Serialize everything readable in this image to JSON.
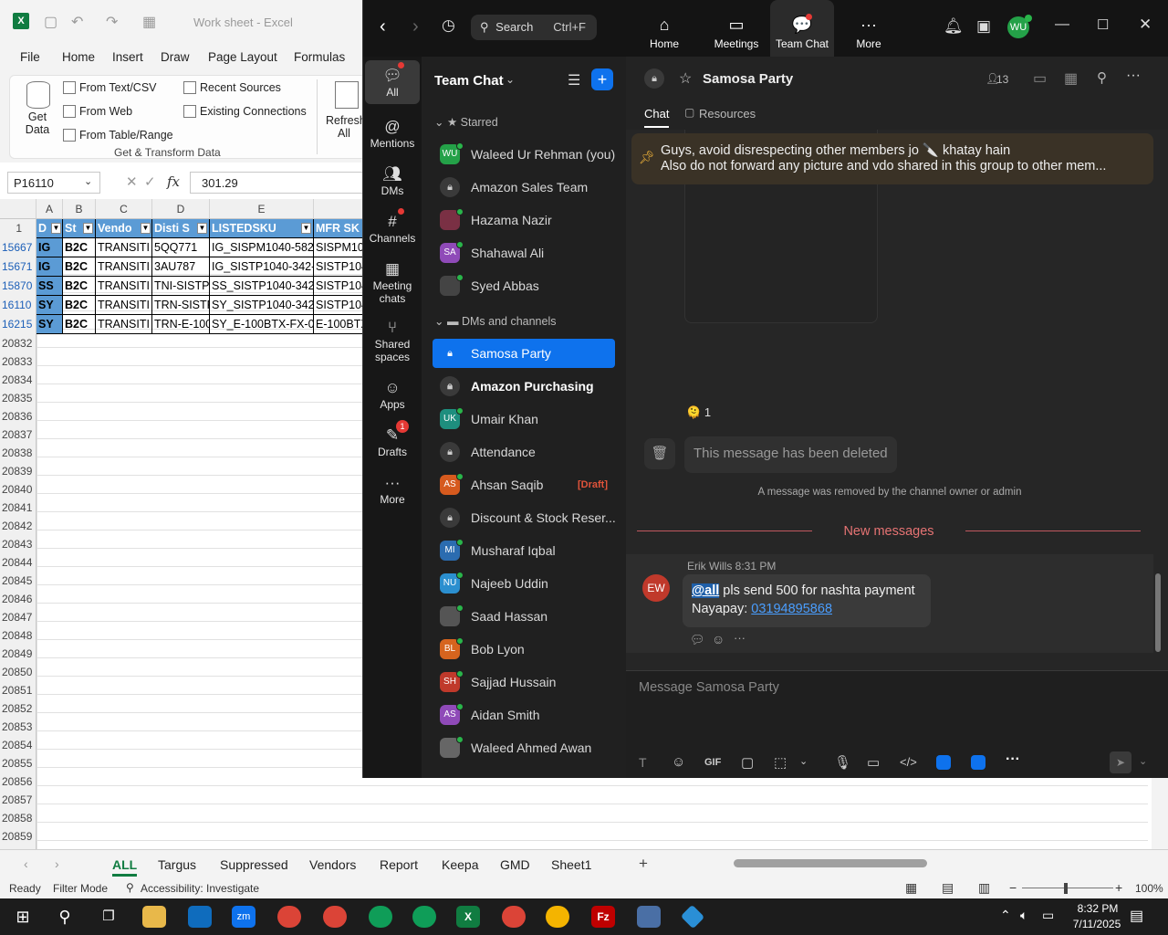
{
  "excel": {
    "title": "Work sheet  -  Excel",
    "menu": [
      "File",
      "Home",
      "Insert",
      "Draw",
      "Page Layout",
      "Formulas"
    ],
    "ribbon": {
      "get_data": "Get\nData",
      "from_text_csv": "From Text/CSV",
      "from_web": "From Web",
      "from_table_range": "From Table/Range",
      "recent_sources": "Recent Sources",
      "existing_connections": "Existing Connections",
      "refresh_all": "Refresh\nAll",
      "group_label": "Get & Transform Data"
    },
    "name_box": "P16110",
    "formula_value": "301.29",
    "columns": [
      "A",
      "B",
      "C",
      "D",
      "E"
    ],
    "header_row": {
      "num": "1",
      "cells": [
        "D",
        "St",
        "Vendo",
        "Disti S",
        "LISTEDSKU",
        "MFR SK"
      ]
    },
    "rows": [
      {
        "num": "15667",
        "cells": [
          "IG",
          "B2C",
          "TRANSITI",
          "5QQ771",
          "IG_SISPM1040-582",
          "SISPM10"
        ]
      },
      {
        "num": "15671",
        "cells": [
          "IG",
          "B2C",
          "TRANSITI",
          "3AU787",
          "IG_SISTP1040-342-",
          "SISTP104"
        ]
      },
      {
        "num": "15870",
        "cells": [
          "SS",
          "B2C",
          "TRANSITI",
          "TNI-SISTP",
          "SS_SISTP1040-342-",
          "SISTP104"
        ]
      },
      {
        "num": "16110",
        "cells": [
          "SY",
          "B2C",
          "TRANSITI",
          "TRN-SISTF",
          "SY_SISTP1040-342-",
          "SISTP104"
        ]
      },
      {
        "num": "16215",
        "cells": [
          "SY",
          "B2C",
          "TRANSITI",
          "TRN-E-100",
          "SY_E-100BTX-FX-0",
          "E-100BTX"
        ]
      }
    ],
    "empty_rows": [
      "20832",
      "20833",
      "20834",
      "20835",
      "20836",
      "20837",
      "20838",
      "20839",
      "20840",
      "20841",
      "20842",
      "20843",
      "20844",
      "20845",
      "20846",
      "20847",
      "20848",
      "20849",
      "20850",
      "20851",
      "20852",
      "20853",
      "20854",
      "20855",
      "20856",
      "20857",
      "20858",
      "20859"
    ],
    "sheets": [
      "ALL",
      "Targus",
      "Suppressed",
      "Vendors",
      "Report",
      "Keepa",
      "GMD",
      "Sheet1"
    ],
    "status": {
      "ready": "Ready",
      "filter": "Filter Mode",
      "accessibility": "Accessibility: Investigate",
      "zoom": "100%"
    }
  },
  "zoom": {
    "search_label": "Search",
    "search_shortcut": "Ctrl+F",
    "nav": [
      "Home",
      "Meetings",
      "Team Chat",
      "More"
    ],
    "user_initials": "WU",
    "rail": [
      {
        "label": "All",
        "icon": "chat-icon"
      },
      {
        "label": "Mentions",
        "icon": "at-icon"
      },
      {
        "label": "DMs",
        "icon": "people-icon"
      },
      {
        "label": "Channels",
        "icon": "hash-icon"
      },
      {
        "label": "Meeting chats",
        "icon": "calendar-icon"
      },
      {
        "label": "Shared spaces",
        "icon": "share-icon"
      },
      {
        "label": "Apps",
        "icon": "apps-icon"
      },
      {
        "label": "Drafts",
        "icon": "drafts-icon",
        "badge": "1"
      },
      {
        "label": "More",
        "icon": "more-icon"
      }
    ],
    "list_title": "Team Chat",
    "starred_label": "Starred",
    "starred": [
      {
        "name": "Waleed Ur Rehman (you)",
        "type": "avatar",
        "initials": "WU",
        "color": "#24a148"
      },
      {
        "name": "Amazon Sales Team",
        "type": "lock"
      },
      {
        "name": "Hazama Nazir",
        "type": "photo",
        "color": "#7a3044"
      },
      {
        "name": "Shahawal Ali",
        "type": "avatar",
        "initials": "SA",
        "color": "#8f4ab8"
      },
      {
        "name": "Syed Abbas",
        "type": "photo",
        "color": "#444"
      }
    ],
    "dms_label": "DMs and channels",
    "dms": [
      {
        "name": "Samosa Party",
        "type": "lock",
        "selected": true
      },
      {
        "name": "Amazon Purchasing",
        "type": "lock",
        "bold": true
      },
      {
        "name": "Umair Khan",
        "type": "avatar",
        "initials": "UK",
        "color": "#1e8e7e"
      },
      {
        "name": "Attendance",
        "type": "lock"
      },
      {
        "name": "Ahsan Saqib",
        "type": "avatar",
        "initials": "AS",
        "color": "#d65a1e",
        "draft": "[Draft]"
      },
      {
        "name": "Discount & Stock Reser...",
        "type": "lock"
      },
      {
        "name": "Musharaf Iqbal",
        "type": "avatar",
        "initials": "MI",
        "color": "#2b6cb0"
      },
      {
        "name": "Najeeb Uddin",
        "type": "avatar",
        "initials": "NU",
        "color": "#2b8fcf"
      },
      {
        "name": "Saad Hassan",
        "type": "photo",
        "color": "#555"
      },
      {
        "name": "Bob Lyon",
        "type": "avatar",
        "initials": "BL",
        "color": "#d6641e"
      },
      {
        "name": "Sajjad Hussain",
        "type": "avatar",
        "initials": "SH",
        "color": "#c0392b"
      },
      {
        "name": "Aidan Smith",
        "type": "avatar",
        "initials": "AS",
        "color": "#8f4ab8"
      },
      {
        "name": "Waleed Ahmed Awan",
        "type": "photo",
        "color": "#666"
      }
    ],
    "channel": {
      "name": "Samosa Party",
      "members": "13",
      "tabs": [
        "Chat",
        "Resources"
      ],
      "pinned_line1": "Guys, avoid disrespecting other members jo 🔪 khatay hain",
      "pinned_line2": "Also do not forward any picture and vdo shared in this group to other mem...",
      "reaction_emoji": "🫠",
      "reaction_count": "1",
      "deleted_text": "This message has been deleted",
      "removed_note": "A message was removed by the channel owner or admin",
      "new_messages": "New messages",
      "message": {
        "initials": "EW",
        "sender": "Erik Wills",
        "time": "8:31 PM",
        "mention": "@all",
        "text1": " pls send 500 for nashta payment",
        "text2_label": "Nayapay: ",
        "phone": "03194895868"
      },
      "input_placeholder": "Message Samosa Party",
      "toolbar_gif": "GIF"
    }
  },
  "taskbar": {
    "time": "8:32 PM",
    "date": "7/11/2025"
  },
  "colors": {
    "zoom_blue": "#0e72ed",
    "excel_green": "#107c41",
    "header_blue": "#5b9bd5"
  }
}
